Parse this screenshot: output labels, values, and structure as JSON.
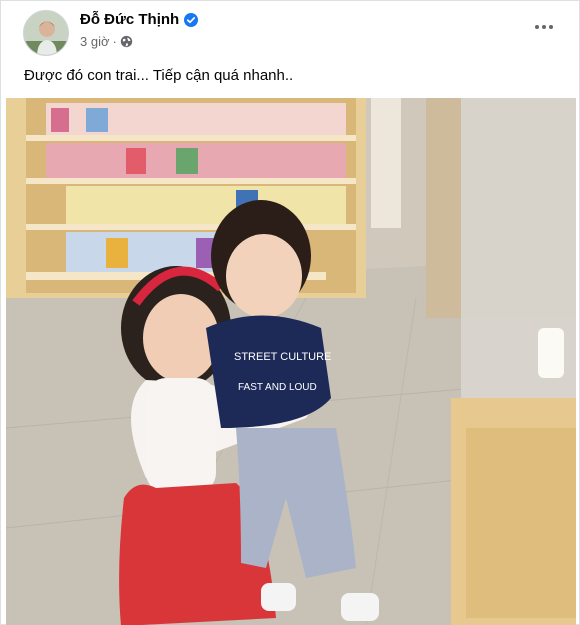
{
  "post": {
    "author": "Đỗ Đức Thịnh",
    "time": "3 giờ",
    "separator": "·",
    "caption": "Được đó con trai... Tiếp cận quá nhanh..",
    "icons": {
      "verified": "verified-badge-icon",
      "privacy": "globe-icon",
      "menu": "more-options-icon"
    },
    "colors": {
      "verified_blue": "#1877f2",
      "secondary_text": "#65676b"
    }
  }
}
